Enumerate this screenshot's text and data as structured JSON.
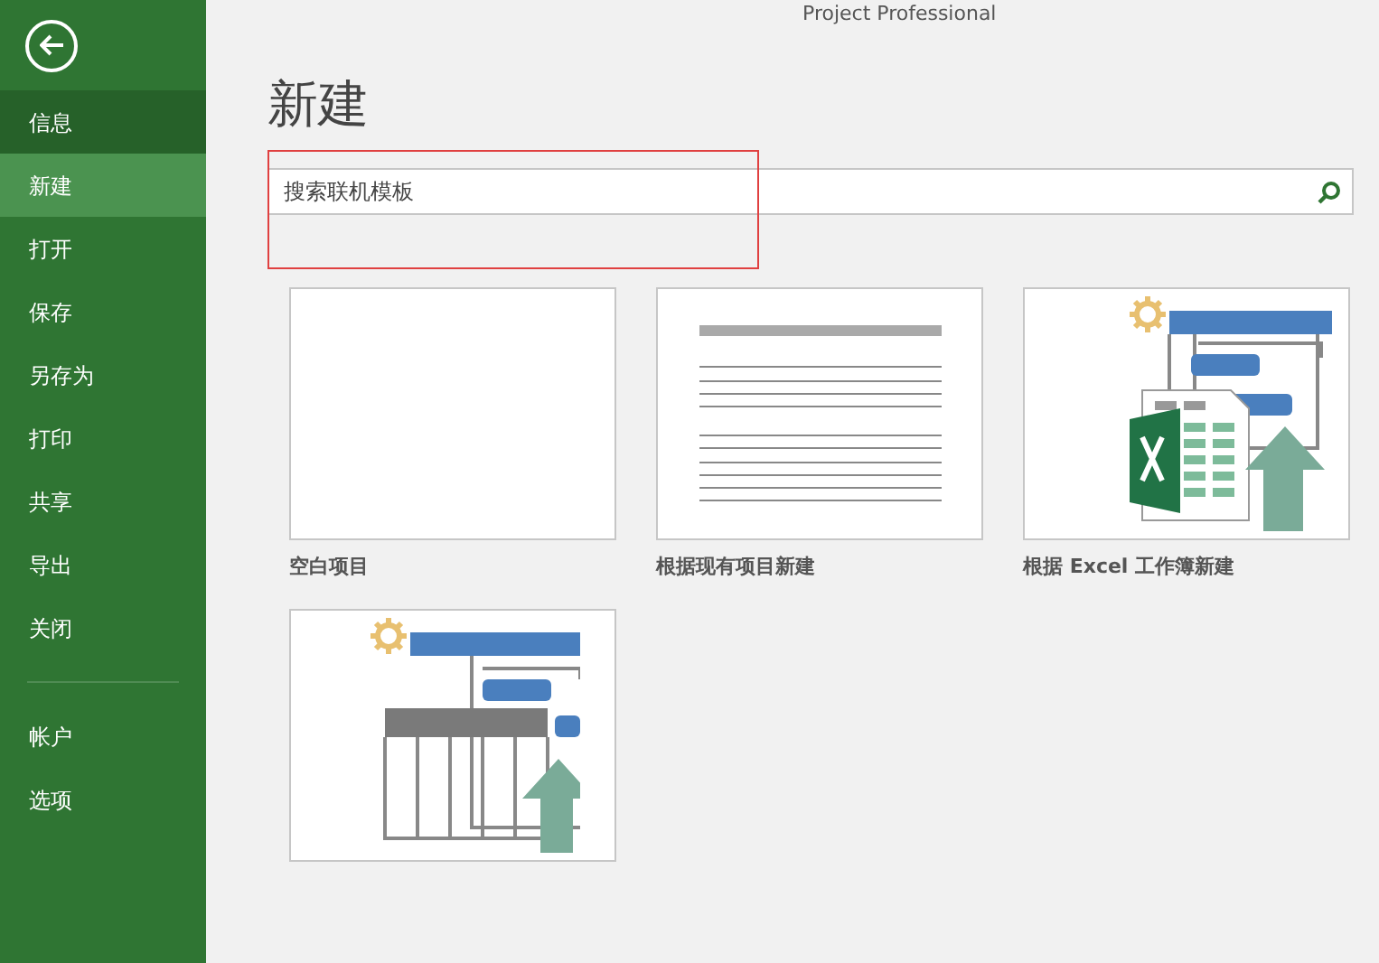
{
  "window": {
    "title": "Project Professional"
  },
  "sidebar": {
    "items": [
      {
        "label": "信息",
        "selected": false,
        "hovered": true
      },
      {
        "label": "新建",
        "selected": true,
        "hovered": false
      },
      {
        "label": "打开",
        "selected": false,
        "hovered": false
      },
      {
        "label": "保存",
        "selected": false,
        "hovered": false
      },
      {
        "label": "另存为",
        "selected": false,
        "hovered": false
      },
      {
        "label": "打印",
        "selected": false,
        "hovered": false
      },
      {
        "label": "共享",
        "selected": false,
        "hovered": false
      },
      {
        "label": "导出",
        "selected": false,
        "hovered": false
      },
      {
        "label": "关闭",
        "selected": false,
        "hovered": false
      }
    ],
    "bottom_items": [
      {
        "label": "帐户",
        "selected": false,
        "hovered": false
      },
      {
        "label": "选项",
        "selected": false,
        "hovered": false
      }
    ]
  },
  "heading": "新建",
  "search": {
    "placeholder": "搜索联机模板"
  },
  "templates": [
    {
      "kind": "blank",
      "label": "空白项目"
    },
    {
      "kind": "existing",
      "label": "根据现有项目新建"
    },
    {
      "kind": "excel",
      "label": "根据 Excel 工作簿新建"
    },
    {
      "kind": "sharepoint"
    }
  ]
}
